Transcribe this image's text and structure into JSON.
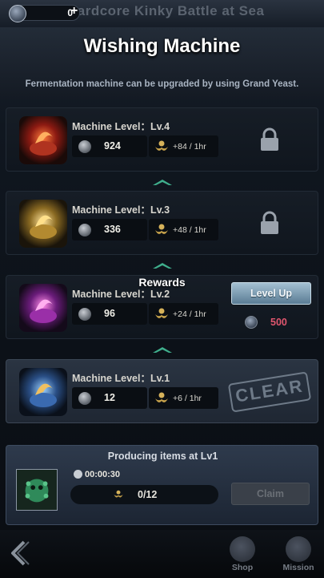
{
  "topbar": {
    "currency_value": "0",
    "currency_plus": "+",
    "background_title": "Hardcore Kinky Battle at Sea"
  },
  "header": {
    "title": "Wishing Machine",
    "subtitle": "Fermentation machine can be upgraded by using Grand Yeast."
  },
  "machines": [
    {
      "level_label": "Machine Level：Lv.4",
      "resource_value": "924",
      "rate": "+84 / 1hr",
      "state": "locked",
      "glow": "#c8321e"
    },
    {
      "level_label": "Machine Level：Lv.3",
      "resource_value": "336",
      "rate": "+48 / 1hr",
      "state": "locked",
      "glow": "#c9a43a"
    },
    {
      "level_label": "Machine Level：Lv.2",
      "resource_value": "96",
      "rate": "+24 / 1hr",
      "state": "upgradable",
      "glow": "#a43ab0"
    },
    {
      "level_label": "Machine Level：Lv.1",
      "resource_value": "12",
      "rate": "+6 / 1hr",
      "state": "cleared",
      "glow": "#3a7ac0"
    }
  ],
  "upgrade": {
    "button_label": "Level Up",
    "cost_value": "500"
  },
  "clear_stamp": "CLEAR",
  "overlay_text": "Rewards",
  "producing": {
    "title": "Producing items at Lv1",
    "timer": "00:00:30",
    "progress_text": "0/12",
    "progress_fraction": 0,
    "claim_label": "Claim"
  },
  "bottom_nav": {
    "shop_label": "Shop",
    "mission_label": "Mission"
  },
  "colors": {
    "cost": "#e0566e",
    "accent_button": "#7fa0b6"
  }
}
